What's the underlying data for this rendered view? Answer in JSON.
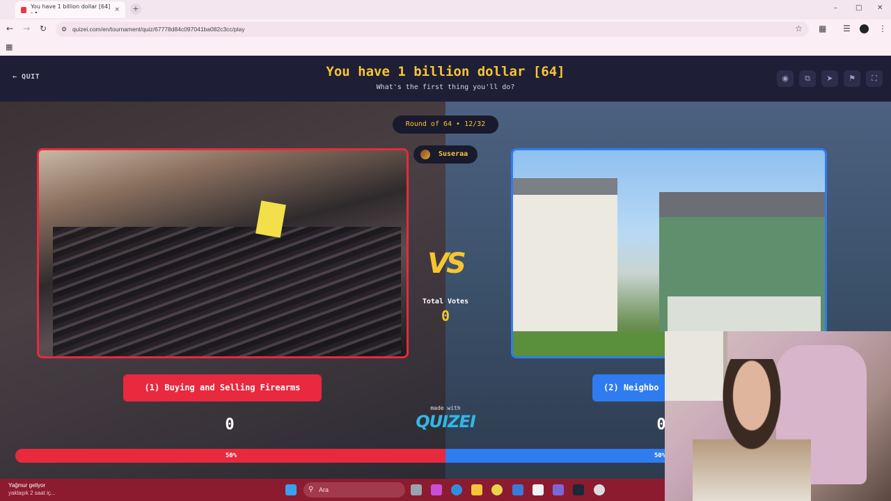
{
  "browser": {
    "tab_title": "You have 1 billion dollar [64] - •",
    "tab_close": "×",
    "new_tab": "+",
    "url": "quizei.com/en/tournament/quiz/67778d84c097041ba082c3cc/play",
    "win_min": "–",
    "win_max": "□",
    "win_close": "✕"
  },
  "header": {
    "quit_label": "QUIT",
    "title": "You have 1 billion dollar [64]",
    "subtitle": "What's the first thing you'll do?"
  },
  "tools": [
    "eye-icon",
    "copy-icon",
    "send-icon",
    "flag-icon",
    "fullscreen-icon"
  ],
  "round": {
    "label": "Round of 64 • 12/32",
    "user": "Suseraa"
  },
  "center": {
    "vs": "VS",
    "total_votes_label": "Total Votes",
    "total_votes_value": "0",
    "made_with": "made with",
    "brand": "QUIZEI"
  },
  "left_option": {
    "label": "(1) Buying and Selling Firearms",
    "votes": "0",
    "percent_label": "50%",
    "percent": 50,
    "color": "#e8293e"
  },
  "right_option": {
    "label": "(2) Neighbo",
    "votes": "0",
    "percent_label": "50%",
    "percent": 50,
    "color": "#2f7bf0"
  },
  "taskbar": {
    "weather_title": "Yağmur geliyor",
    "weather_sub": "yaklaşık 2 saat iç...",
    "search_placeholder": "Ara"
  }
}
